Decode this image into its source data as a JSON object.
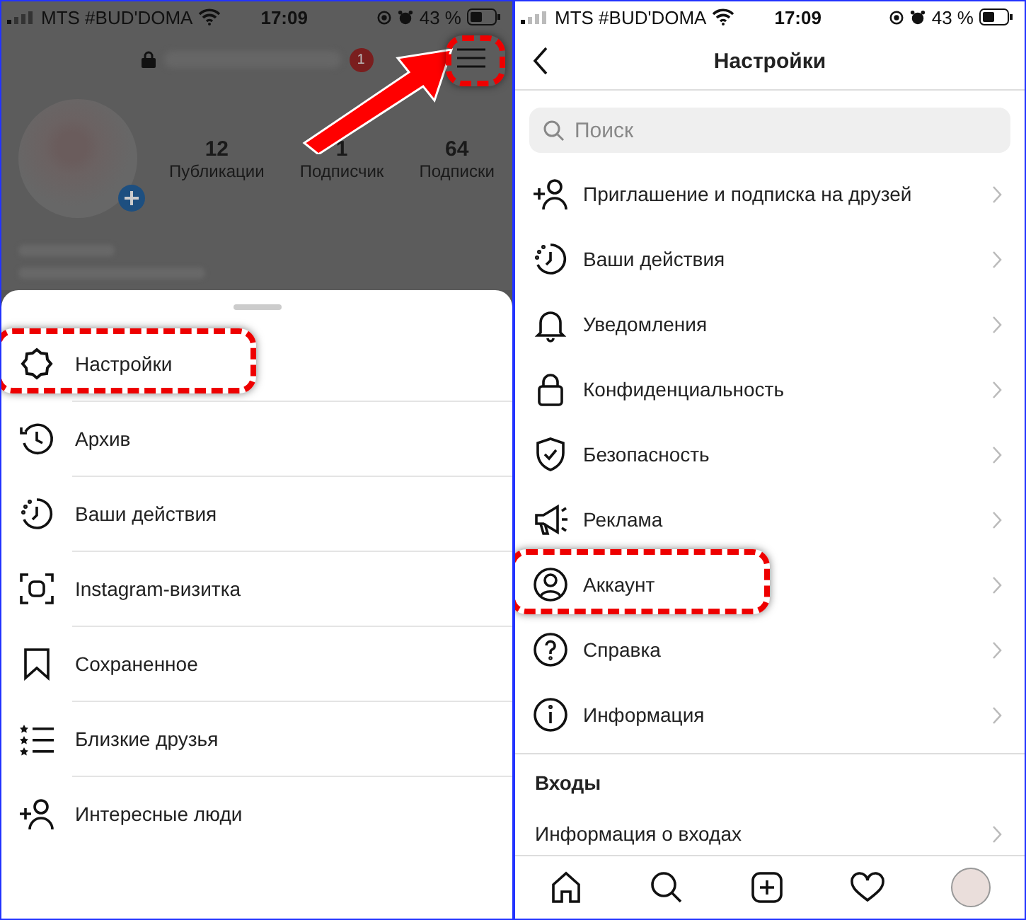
{
  "left": {
    "status_bar": {
      "carrier": "MTS #BUD'DOMA",
      "time": "17:09",
      "battery": "43 %"
    },
    "profile": {
      "notification_count": "1",
      "stats": [
        {
          "value": "12",
          "label": "Публикации"
        },
        {
          "value": "1",
          "label": "Подписчик"
        },
        {
          "value": "64",
          "label": "Подписки"
        }
      ]
    },
    "menu": {
      "items": [
        {
          "label": "Настройки",
          "highlighted": true
        },
        {
          "label": "Архив",
          "highlighted": false
        },
        {
          "label": "Ваши действия",
          "highlighted": false
        },
        {
          "label": "Instagram-визитка",
          "highlighted": false
        },
        {
          "label": "Сохраненное",
          "highlighted": false
        },
        {
          "label": "Близкие друзья",
          "highlighted": false
        },
        {
          "label": "Интересные люди",
          "highlighted": false
        }
      ]
    }
  },
  "right": {
    "status_bar": {
      "carrier": "MTS #BUD'DOMA",
      "time": "17:09",
      "battery": "43 %"
    },
    "title": "Настройки",
    "search": {
      "placeholder": "Поиск"
    },
    "items": [
      {
        "label": "Приглашение и подписка на друзей",
        "highlighted": false
      },
      {
        "label": "Ваши действия",
        "highlighted": false
      },
      {
        "label": "Уведомления",
        "highlighted": false
      },
      {
        "label": "Конфиденциальность",
        "highlighted": false
      },
      {
        "label": "Безопасность",
        "highlighted": false
      },
      {
        "label": "Реклама",
        "highlighted": false
      },
      {
        "label": "Аккаунт",
        "highlighted": true
      },
      {
        "label": "Справка",
        "highlighted": false
      },
      {
        "label": "Информация",
        "highlighted": false
      }
    ],
    "section": {
      "title": "Входы",
      "items": [
        {
          "label": "Информация о входах"
        }
      ]
    }
  }
}
